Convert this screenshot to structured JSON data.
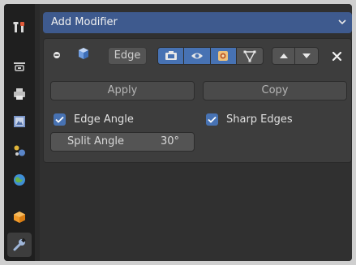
{
  "tabs": [
    {
      "id": "tool",
      "icon": "tool-settings-icon",
      "active": false
    },
    {
      "id": "render",
      "icon": "render-properties-icon",
      "active": false
    },
    {
      "id": "output",
      "icon": "output-properties-icon",
      "active": false
    },
    {
      "id": "view_layer",
      "icon": "view-layer-icon",
      "active": false
    },
    {
      "id": "scene",
      "icon": "scene-properties-icon",
      "active": false
    },
    {
      "id": "world",
      "icon": "world-properties-icon",
      "active": false
    },
    {
      "id": "object",
      "icon": "object-properties-icon",
      "active": false
    },
    {
      "id": "modifier",
      "icon": "modifier-wrench-icon",
      "active": true
    }
  ],
  "add_modifier": {
    "label": "Add Modifier"
  },
  "modifier": {
    "name": "Edge",
    "toggles": [
      "edit-mode-icon",
      "realtime-eye-icon",
      "render-camera-icon",
      "cage-vertex-icon"
    ],
    "apply_label": "Apply",
    "copy_label": "Copy",
    "edge_angle": {
      "label": "Edge Angle",
      "checked": true
    },
    "sharp_edges": {
      "label": "Sharp Edges",
      "checked": true
    },
    "split_angle": {
      "label": "Split Angle",
      "value": "30°"
    }
  },
  "colors": {
    "accent": "#4772b3",
    "add_modifier_bg": "#3e5a8e",
    "panel_bg": "#3d3d3d"
  }
}
